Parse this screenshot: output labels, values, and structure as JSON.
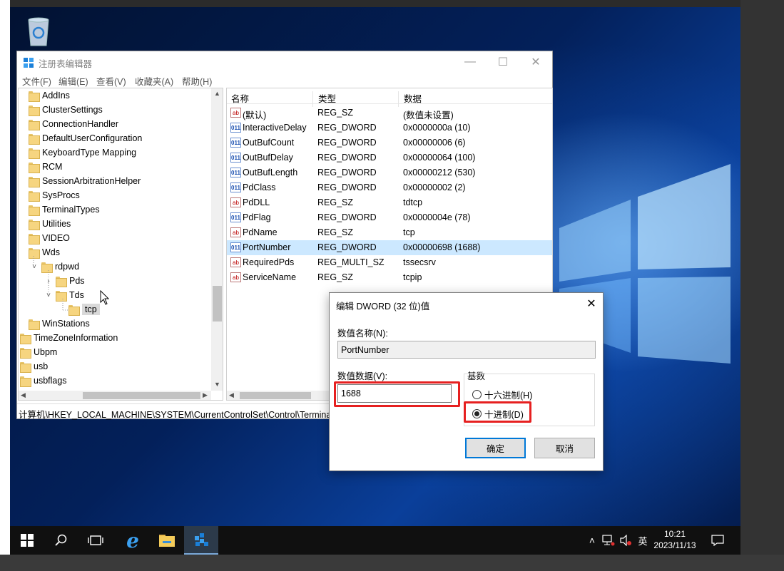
{
  "regedit": {
    "title": "注册表编辑器",
    "menu": [
      "文件(F)",
      "编辑(E)",
      "查看(V)",
      "收藏夹(A)",
      "帮助(H)"
    ],
    "tree": [
      {
        "label": "AddIns",
        "indent": 0,
        "exp": ""
      },
      {
        "label": "ClusterSettings",
        "indent": 0,
        "exp": ""
      },
      {
        "label": "ConnectionHandler",
        "indent": 0,
        "exp": ""
      },
      {
        "label": "DefaultUserConfiguration",
        "indent": 0,
        "exp": ""
      },
      {
        "label": "KeyboardType Mapping",
        "indent": 0,
        "exp": ""
      },
      {
        "label": "RCM",
        "indent": 0,
        "exp": ""
      },
      {
        "label": "SessionArbitrationHelper",
        "indent": 0,
        "exp": ""
      },
      {
        "label": "SysProcs",
        "indent": 0,
        "exp": ""
      },
      {
        "label": "TerminalTypes",
        "indent": 0,
        "exp": ""
      },
      {
        "label": "Utilities",
        "indent": 0,
        "exp": ""
      },
      {
        "label": "VIDEO",
        "indent": 0,
        "exp": ""
      },
      {
        "label": "Wds",
        "indent": 0,
        "exp": ""
      },
      {
        "label": "rdpwd",
        "indent": 1,
        "exp": "˅"
      },
      {
        "label": "Pds",
        "indent": 2,
        "exp": "›"
      },
      {
        "label": "Tds",
        "indent": 2,
        "exp": "˅"
      },
      {
        "label": "tcp",
        "indent": 3,
        "exp": ""
      },
      {
        "label": "WinStations",
        "indent": 0,
        "exp": ""
      },
      {
        "label": "TimeZoneInformation",
        "indent": -1,
        "exp": ""
      },
      {
        "label": "Ubpm",
        "indent": -1,
        "exp": ""
      },
      {
        "label": "usb",
        "indent": -1,
        "exp": ""
      },
      {
        "label": "usbflags",
        "indent": -1,
        "exp": ""
      }
    ],
    "columns": {
      "name": "名称",
      "type": "类型",
      "data": "数据"
    },
    "values": [
      {
        "name": "(默认)",
        "type": "REG_SZ",
        "data": "(数值未设置)",
        "icon": "sz"
      },
      {
        "name": "InteractiveDelay",
        "type": "REG_DWORD",
        "data": "0x0000000a (10)",
        "icon": "dw"
      },
      {
        "name": "OutBufCount",
        "type": "REG_DWORD",
        "data": "0x00000006 (6)",
        "icon": "dw"
      },
      {
        "name": "OutBufDelay",
        "type": "REG_DWORD",
        "data": "0x00000064 (100)",
        "icon": "dw"
      },
      {
        "name": "OutBufLength",
        "type": "REG_DWORD",
        "data": "0x00000212 (530)",
        "icon": "dw"
      },
      {
        "name": "PdClass",
        "type": "REG_DWORD",
        "data": "0x00000002 (2)",
        "icon": "dw"
      },
      {
        "name": "PdDLL",
        "type": "REG_SZ",
        "data": "tdtcp",
        "icon": "sz"
      },
      {
        "name": "PdFlag",
        "type": "REG_DWORD",
        "data": "0x0000004e (78)",
        "icon": "dw"
      },
      {
        "name": "PdName",
        "type": "REG_SZ",
        "data": "tcp",
        "icon": "sz"
      },
      {
        "name": "PortNumber",
        "type": "REG_DWORD",
        "data": "0x00000698 (1688)",
        "icon": "dw"
      },
      {
        "name": "RequiredPds",
        "type": "REG_MULTI_SZ",
        "data": "tssecsrv",
        "icon": "sz"
      },
      {
        "name": "ServiceName",
        "type": "REG_SZ",
        "data": "tcpip",
        "icon": "sz"
      }
    ],
    "status_path": "计算机\\HKEY_LOCAL_MACHINE\\SYSTEM\\CurrentControlSet\\Control\\Termina"
  },
  "dialog": {
    "title": "编辑 DWORD (32 位)值",
    "name_label": "数值名称(N):",
    "name_value": "PortNumber",
    "data_label": "数值数据(V):",
    "data_value": "1688",
    "base_label": "基数",
    "hex_label": "十六进制(H)",
    "dec_label": "十进制(D)",
    "ok": "确定",
    "cancel": "取消"
  },
  "taskbar": {
    "time": "10:21",
    "date": "2023/11/13",
    "ime": "英"
  }
}
